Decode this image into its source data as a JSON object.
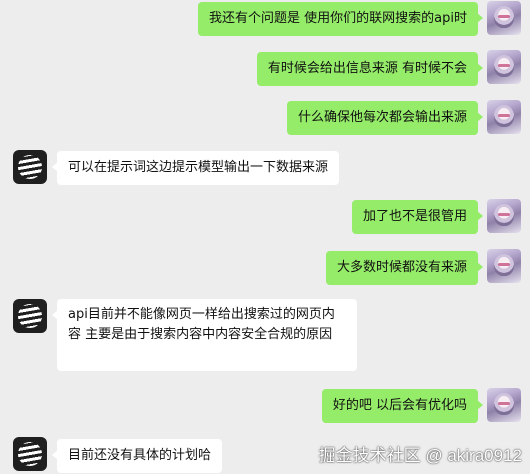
{
  "messages": [
    {
      "sender": "user",
      "text": "我还有个问题是 使用你们的联网搜索的api时"
    },
    {
      "sender": "user",
      "text": "有时候会给出信息来源 有时候不会"
    },
    {
      "sender": "user",
      "text": "什么确保他每次都会输出来源"
    },
    {
      "sender": "bot",
      "text": "可以在提示词这边提示模型输出一下数据来源"
    },
    {
      "sender": "user",
      "text": "加了也不是很管用"
    },
    {
      "sender": "user",
      "text": "大多数时候都没有来源"
    },
    {
      "sender": "bot",
      "text": "api目前并不能像网页一样给出搜索过的网页内容 主要是由于搜索内容中内容安全合规的原因"
    },
    {
      "sender": "user",
      "text": "好的吧 以后会有优化吗"
    },
    {
      "sender": "bot",
      "text": "目前还没有具体的计划哈"
    }
  ],
  "watermark": "掘金技术社区 @ akira0912",
  "colors": {
    "outgoing_bubble": "#95ec69",
    "incoming_bubble": "#ffffff",
    "background": "#ededed"
  }
}
